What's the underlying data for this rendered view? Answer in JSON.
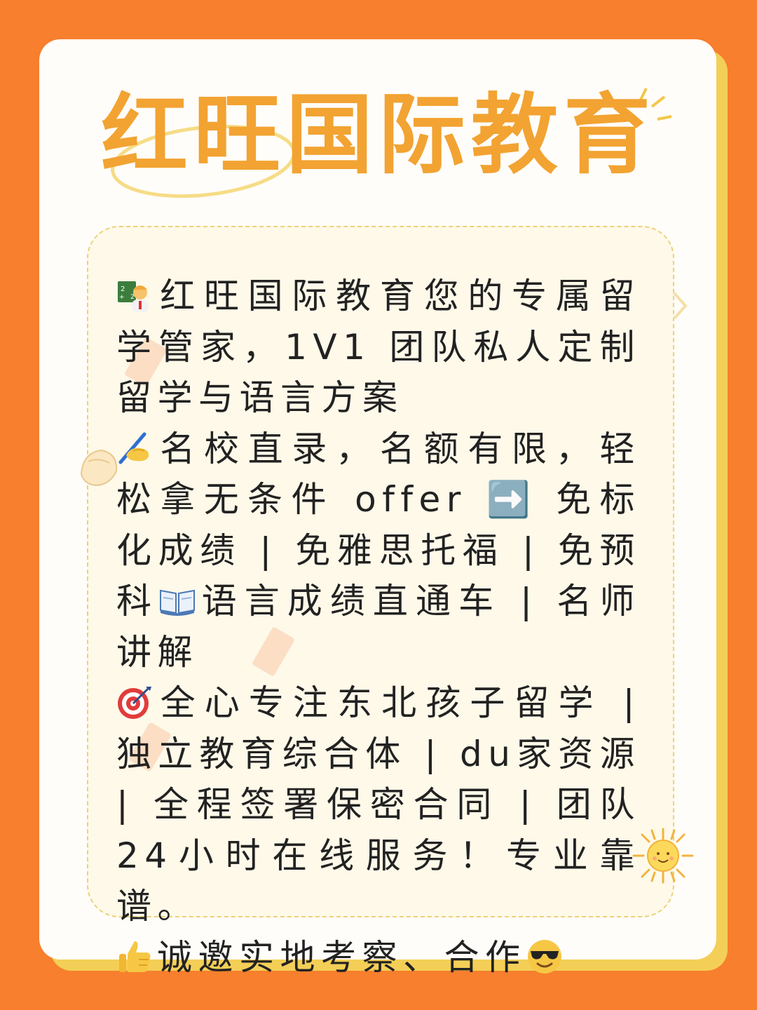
{
  "title": "红旺国际教育",
  "colors": {
    "background": "#f77f2d",
    "card": "#fffdf9",
    "card_shadow": "#f3cf57",
    "title": "#f2a332",
    "panel": "#fef9e9",
    "panel_border": "#ecd27a",
    "text": "#222222"
  },
  "paragraphs": [
    {
      "icon": "teacher-icon",
      "text": "红旺国际教育您的专属留学管家，1V1 团队私人定制留学与语言方案"
    },
    {
      "icon": "writing-hand-icon",
      "text": "名校直录，名额有限，轻松拿无条件 offer ➡️ 免标化成绩 | 免雅思托福 | 免预科",
      "icon2": "open-book-icon",
      "text2": "语言成绩直通车 | 名师讲解"
    },
    {
      "icon": "bullseye-icon",
      "text": "全心专注东北孩子留学 | 独立教育综合体 | du家资源 | 全程签署保密合同 | 团队24小时在线服务！专业靠谱。"
    },
    {
      "icon": "thumbs-up-icon",
      "text": "诚邀实地考察、合作",
      "icon2": "sunglasses-face-icon"
    }
  ]
}
